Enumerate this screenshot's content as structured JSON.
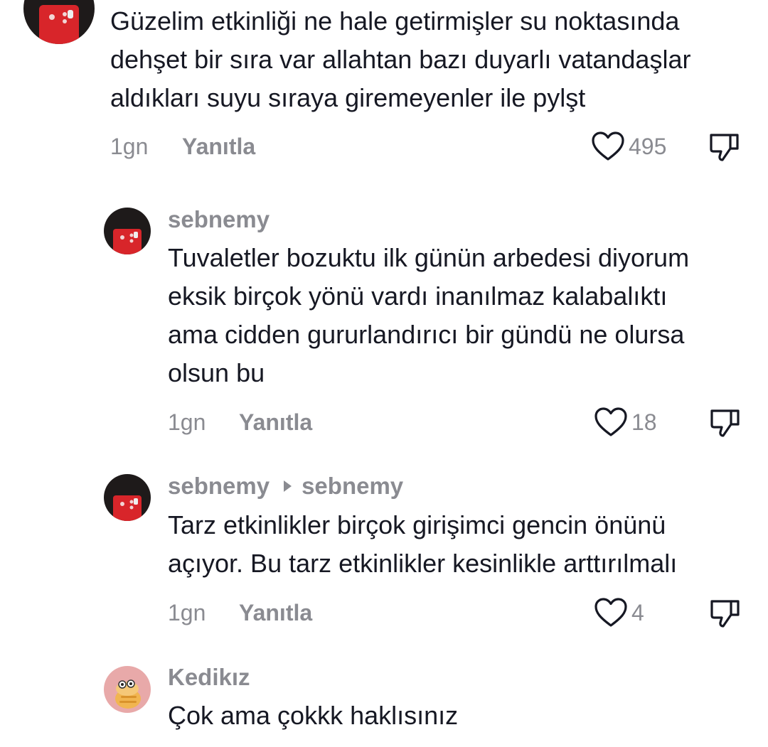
{
  "colors": {
    "text_primary": "#161823",
    "text_secondary": "#8a8b91",
    "avatar_phone_red": "#d8252a"
  },
  "comments": [
    {
      "username": "",
      "text_lines": [
        "Güzelim etkinliği ne hale getirmişler su noktasında",
        "dehşet bir sıra var allahtan bazı duyarlı vatandaşlar",
        "aldıkları suyu sıraya giremeyenler ile pylşt"
      ],
      "time": "1gn",
      "reply_label": "Yanıtla",
      "likes": "495",
      "icons": [
        "heart-icon",
        "thumbs-down-icon"
      ]
    },
    {
      "username": "sebnemy",
      "text_lines": [
        "Tuvaletler bozuktu ilk günün arbedesi diyorum",
        "eksik birçok yönü vardı inanılmaz kalabalıktı",
        "ama cidden gururlandırıcı bir gündü ne olursa",
        "olsun bu"
      ],
      "time": "1gn",
      "reply_label": "Yanıtla",
      "likes": "18"
    },
    {
      "username": "sebnemy",
      "reply_to": "sebnemy",
      "text_lines": [
        "Tarz etkinlikler birçok girişimci gencin önünü",
        "açıyor. Bu tarz etkinlikler kesinlikle arttırılmalı"
      ],
      "time": "1gn",
      "reply_label": "Yanıtla",
      "likes": "4"
    },
    {
      "username": "Kedikız",
      "text_lines": [
        "Çok ama çokkk haklısınız"
      ]
    }
  ]
}
